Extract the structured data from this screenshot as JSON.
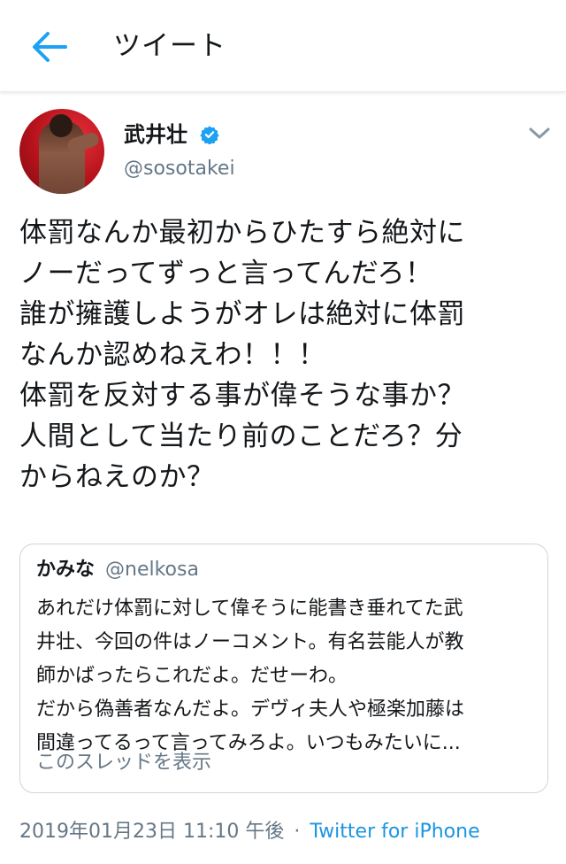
{
  "header": {
    "title": "ツイート"
  },
  "author": {
    "name": "武井壮",
    "handle": "@sosotakei"
  },
  "tweet": {
    "lines": [
      "体罰なんか最初からひたすら絶対に",
      "ノーだってずっと言ってんだろ！",
      "誰が擁護しようがオレは絶対に体罰",
      "なんか認めねえわ！！！",
      "体罰を反対する事が偉そうな事か？",
      "人間として当たり前のことだろ？分",
      "からねえのか？"
    ]
  },
  "quote": {
    "name": "かみな",
    "handle": "@nelkosa",
    "lines": [
      "あれだけ体罰に対して偉そうに能書き垂れてた武",
      "井壮、今回の件はノーコメント。有名芸能人が教",
      "師かばったらこれだよ。だせーわ。",
      "だから偽善者なんだよ。デヴィ夫人や極楽加藤は",
      "間違ってるって言ってみろよ。いつもみたいに..."
    ],
    "show_thread": "このスレッドを表示"
  },
  "footer": {
    "timestamp": "2019年01月23日 11:10 午後",
    "separator": "·",
    "client": "Twitter for iPhone"
  },
  "colors": {
    "accent": "#1b95e0",
    "muted": "#657786",
    "text": "#14171a",
    "border": "#ccd6dd"
  },
  "icons": {
    "back": "arrow-left-icon",
    "verified": "verified-badge-icon",
    "menu": "chevron-down-icon"
  }
}
